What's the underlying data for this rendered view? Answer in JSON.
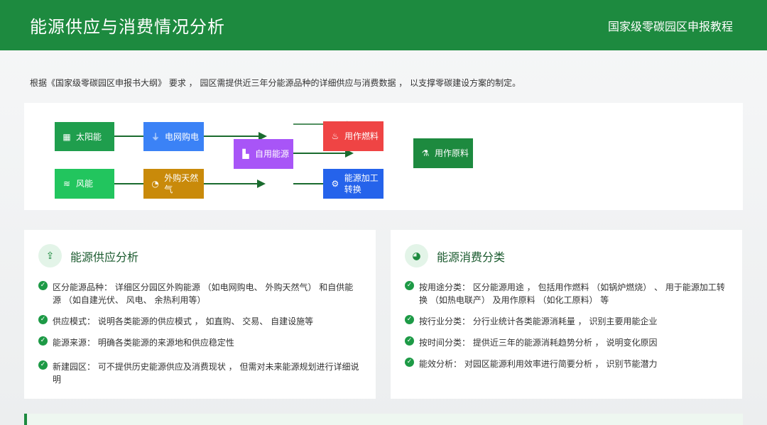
{
  "header": {
    "title": "能源供应与消费情况分析",
    "brand": "国家级零碳园区申报教程"
  },
  "intro": "根据《国家级零碳园区申报书大纲》 要求 ， 园区需提供近三年分能源品种的详细供应与消费数据 ， 以支撑零碳建设方案的制定。",
  "flow": {
    "solar": {
      "label": "太阳能",
      "icon": "solar-panel-icon",
      "color": "#1f9e4d"
    },
    "wind": {
      "label": "风能",
      "icon": "wind-icon",
      "color": "#22c55e"
    },
    "grid": {
      "label": "电网购电",
      "icon": "plug-icon",
      "color": "#3b82f6"
    },
    "gas": {
      "label": "外购天然气",
      "icon": "gas-icon",
      "color": "#c98a0a"
    },
    "self": {
      "label": "自用能源",
      "icon": "factory-icon",
      "color": "#a855f7"
    },
    "fuel": {
      "label": "用作燃料",
      "icon": "flame-icon",
      "color": "#ef4444"
    },
    "convert": {
      "label": "能源加工转换",
      "icon": "gears-icon",
      "color": "#2563eb"
    },
    "raw": {
      "label": "用作原料",
      "icon": "flask-icon",
      "color": "#1d8a3f"
    }
  },
  "supply": {
    "title": "能源供应分析",
    "icon": "upload-icon",
    "items": [
      "区分能源品种： 详细区分园区外购能源 （如电网购电、 外购天然气） 和自供能源 （如自建光伏、 风电、 余热利用等）",
      "供应模式： 说明各类能源的供应模式 ， 如直购、 交易、 自建设施等",
      "能源来源： 明确各类能源的来源地和供应稳定性",
      "新建园区： 可不提供历史能源供应及消费现状 ， 但需对未来能源规划进行详细说明"
    ]
  },
  "consume": {
    "title": "能源消费分类",
    "icon": "pie-chart-icon",
    "items": [
      "按用途分类： 区分能源用途 ， 包括用作燃料 （如锅炉燃烧） 、 用于能源加工转换 （如热电联产） 及用作原料 （如化工原料） 等",
      "按行业分类： 分行业统计各类能源消耗量 ， 识别主要用能企业",
      "按时间分类： 提供近三年的能源消耗趋势分析 ， 说明变化原因",
      "能效分析： 对园区能源利用效率进行简要分析 ， 识别节能潜力"
    ]
  }
}
